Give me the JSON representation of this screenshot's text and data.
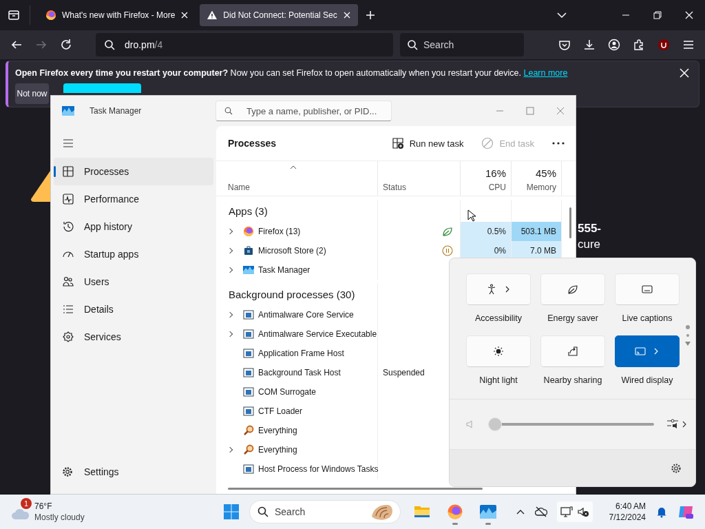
{
  "browser": {
    "tabs": [
      {
        "title": "What's new with Firefox - More",
        "kind": "firefox",
        "selected": false
      },
      {
        "title": "Did Not Connect: Potential Sec",
        "kind": "warning",
        "selected": true
      }
    ],
    "address": {
      "host": "dro.pm",
      "path": "/4"
    },
    "search": {
      "placeholder": "Search"
    },
    "notification": {
      "bold": "Open Firefox every time you restart your computer?",
      "text": "Now you can set Firefox to open automatically when you restart your device.",
      "link": "Learn more",
      "dismiss": "Not now"
    },
    "page": {
      "fragments": [
        "555-",
        "cure"
      ]
    }
  },
  "task_manager": {
    "title": "Task Manager",
    "search": {
      "placeholder": "Type a name, publisher, or PID..."
    },
    "nav": [
      {
        "label": "Processes",
        "kind": "processes",
        "selected": true
      },
      {
        "label": "Performance",
        "kind": "performance",
        "selected": false
      },
      {
        "label": "App history",
        "kind": "history",
        "selected": false
      },
      {
        "label": "Startup apps",
        "kind": "startup",
        "selected": false
      },
      {
        "label": "Users",
        "kind": "users",
        "selected": false
      },
      {
        "label": "Details",
        "kind": "details",
        "selected": false
      },
      {
        "label": "Services",
        "kind": "services",
        "selected": false
      }
    ],
    "settings": "Settings",
    "heading": "Processes",
    "actions": [
      {
        "label": "Run new task",
        "kind": "run",
        "disabled": false
      },
      {
        "label": "End task",
        "kind": "end",
        "disabled": true
      }
    ],
    "columns": {
      "name": "Name",
      "status": "Status",
      "cpu_total": "16%",
      "cpu": "CPU",
      "memory_total": "45%",
      "memory": "Memory"
    },
    "groups": [
      {
        "title": "Apps (3)",
        "rows": [
          {
            "name": "Firefox (13)",
            "kind": "firefox",
            "expandable": true,
            "efficiency_mode": true,
            "suspended": false,
            "cpu": "0.5%",
            "memory": "503.1 MB",
            "highlighted": true
          },
          {
            "name": "Microsoft Store (2)",
            "kind": "store",
            "expandable": true,
            "efficiency_mode": false,
            "suspended": true,
            "cpu": "0%",
            "memory": "7.0 MB",
            "highlighted": false
          },
          {
            "name": "Task Manager",
            "kind": "taskmgr",
            "expandable": true,
            "efficiency_mode": false,
            "suspended": false
          }
        ]
      },
      {
        "title": "Background processes (30)",
        "rows": [
          {
            "name": "Antimalware Core Service",
            "kind": "service",
            "expandable": true,
            "efficiency_mode": false,
            "suspended": false
          },
          {
            "name": "Antimalware Service Executable",
            "kind": "service",
            "expandable": true,
            "efficiency_mode": false,
            "suspended": false
          },
          {
            "name": "Application Frame Host",
            "kind": "service",
            "expandable": false,
            "efficiency_mode": false,
            "suspended": false
          },
          {
            "name": "Background Task Host",
            "kind": "service",
            "expandable": false,
            "efficiency_mode": false,
            "suspended": false,
            "status": "Suspended"
          },
          {
            "name": "COM Surrogate",
            "kind": "service",
            "expandable": false,
            "efficiency_mode": false,
            "suspended": false
          },
          {
            "name": "CTF Loader",
            "kind": "service",
            "expandable": false,
            "efficiency_mode": false,
            "suspended": false
          },
          {
            "name": "Everything",
            "kind": "everything",
            "expandable": false,
            "efficiency_mode": false,
            "suspended": false
          },
          {
            "name": "Everything",
            "kind": "everything",
            "expandable": true,
            "efficiency_mode": false,
            "suspended": false
          },
          {
            "name": "Host Process for Windows Tasks",
            "kind": "service",
            "expandable": false,
            "efficiency_mode": false,
            "suspended": false
          }
        ]
      }
    ]
  },
  "quick_settings": {
    "tiles": [
      {
        "label": "Accessibility",
        "kind": "accessibility",
        "chevron": true,
        "on": false
      },
      {
        "label": "Energy saver",
        "kind": "leaf",
        "chevron": false,
        "on": false
      },
      {
        "label": "Live captions",
        "kind": "captions",
        "chevron": false,
        "on": false
      },
      {
        "label": "Night light",
        "kind": "brightness",
        "chevron": false,
        "on": false
      },
      {
        "label": "Nearby sharing",
        "kind": "share",
        "chevron": false,
        "on": false
      },
      {
        "label": "Wired display",
        "kind": "cast",
        "chevron": true,
        "on": true
      }
    ],
    "volume": {
      "level": 0
    }
  },
  "taskbar": {
    "weather": {
      "badge": "1",
      "temperature": "76°F",
      "condition": "Mostly cloudy"
    },
    "search": {
      "placeholder": "Search"
    },
    "apps": [
      {
        "kind": "explorer",
        "running": false
      },
      {
        "kind": "firefox",
        "running": true
      },
      {
        "kind": "taskmgr",
        "running": true
      }
    ],
    "clock": {
      "time": "6:40 AM",
      "date": "7/12/2024"
    }
  }
}
